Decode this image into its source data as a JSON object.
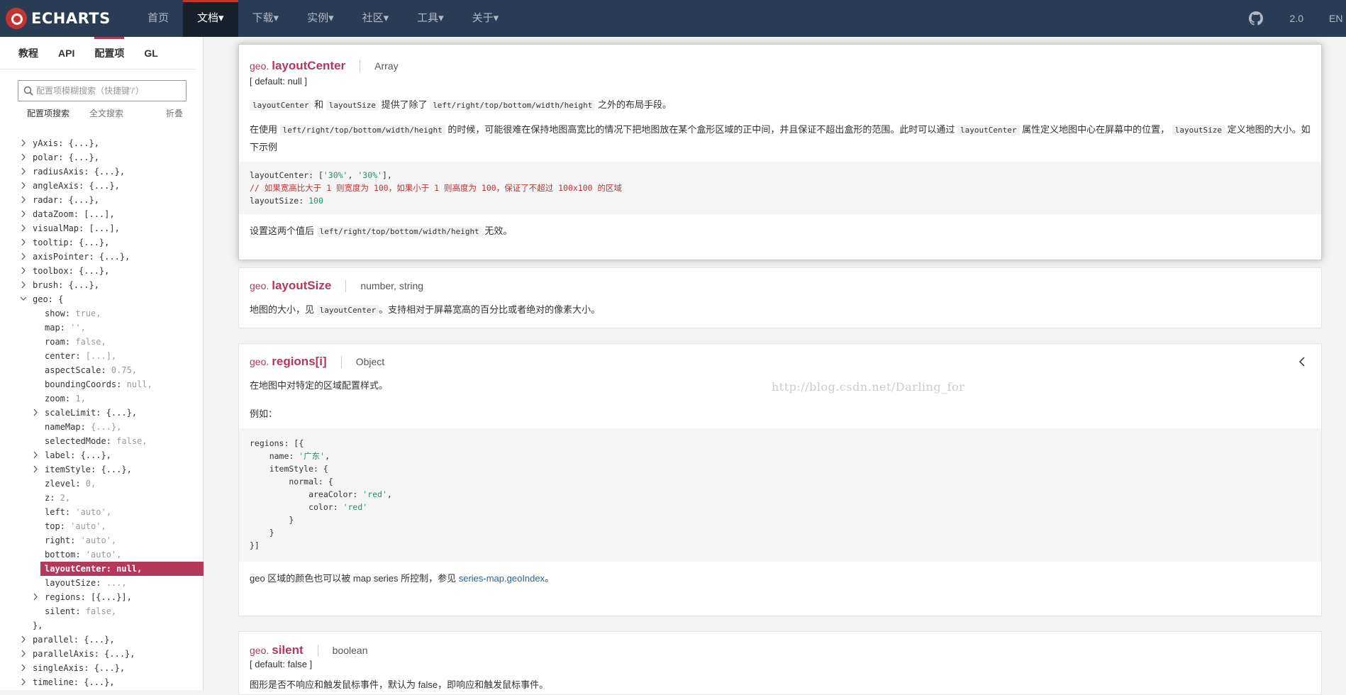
{
  "navbar": {
    "brand": "ECHARTS",
    "items": [
      {
        "label": "首页"
      },
      {
        "label": "文档▾"
      },
      {
        "label": "下载▾"
      },
      {
        "label": "实例▾"
      },
      {
        "label": "社区▾"
      },
      {
        "label": "工具▾"
      },
      {
        "label": "关于▾"
      }
    ],
    "version": "2.0",
    "lang": "EN"
  },
  "sidebar": {
    "tabs": [
      "教程",
      "API",
      "配置项",
      "GL"
    ],
    "search_placeholder": "配置项模糊搜索（快捷键'/'）",
    "search_opt1": "配置项搜索",
    "search_opt2": "全文搜索",
    "collapse": "折叠",
    "tree": [
      {
        "key": "yAxis: {...},",
        "val": "",
        "arrow": "right",
        "indent": 0
      },
      {
        "key": "polar: {...},",
        "val": "",
        "arrow": "right",
        "indent": 0
      },
      {
        "key": "radiusAxis: {...},",
        "val": "",
        "arrow": "right",
        "indent": 0
      },
      {
        "key": "angleAxis: {...},",
        "val": "",
        "arrow": "right",
        "indent": 0
      },
      {
        "key": "radar: {...},",
        "val": "",
        "arrow": "right",
        "indent": 0
      },
      {
        "key": "dataZoom: [...],",
        "val": "",
        "arrow": "right",
        "indent": 0
      },
      {
        "key": "visualMap: [...],",
        "val": "",
        "arrow": "right",
        "indent": 0
      },
      {
        "key": "tooltip: {...},",
        "val": "",
        "arrow": "right",
        "indent": 0
      },
      {
        "key": "axisPointer: {...},",
        "val": "",
        "arrow": "right",
        "indent": 0
      },
      {
        "key": "toolbox: {...},",
        "val": "",
        "arrow": "right",
        "indent": 0
      },
      {
        "key": "brush: {...},",
        "val": "",
        "arrow": "right",
        "indent": 0
      },
      {
        "key": "geo: {",
        "val": "",
        "arrow": "down",
        "indent": 0
      },
      {
        "key": "show: ",
        "val": "true,",
        "arrow": "",
        "indent": 1
      },
      {
        "key": "map: ",
        "val": "'',",
        "arrow": "",
        "indent": 1
      },
      {
        "key": "roam: ",
        "val": "false,",
        "arrow": "",
        "indent": 1
      },
      {
        "key": "center: ",
        "val": "[...],",
        "arrow": "",
        "indent": 1
      },
      {
        "key": "aspectScale: ",
        "val": "0.75,",
        "arrow": "",
        "indent": 1
      },
      {
        "key": "boundingCoords: ",
        "val": "null,",
        "arrow": "",
        "indent": 1
      },
      {
        "key": "zoom: ",
        "val": "1,",
        "arrow": "",
        "indent": 1
      },
      {
        "key": "scaleLimit: {...},",
        "val": "",
        "arrow": "right",
        "indent": 1
      },
      {
        "key": "nameMap: ",
        "val": "{...},",
        "arrow": "",
        "indent": 1
      },
      {
        "key": "selectedMode: ",
        "val": "false,",
        "arrow": "",
        "indent": 1
      },
      {
        "key": "label: {...},",
        "val": "",
        "arrow": "right",
        "indent": 1
      },
      {
        "key": "itemStyle: {...},",
        "val": "",
        "arrow": "right",
        "indent": 1
      },
      {
        "key": "zlevel: ",
        "val": "0,",
        "arrow": "",
        "indent": 1
      },
      {
        "key": "z: ",
        "val": "2,",
        "arrow": "",
        "indent": 1
      },
      {
        "key": "left: ",
        "val": "'auto',",
        "arrow": "",
        "indent": 1
      },
      {
        "key": "top: ",
        "val": "'auto',",
        "arrow": "",
        "indent": 1
      },
      {
        "key": "right: ",
        "val": "'auto',",
        "arrow": "",
        "indent": 1
      },
      {
        "key": "bottom: ",
        "val": "'auto',",
        "arrow": "",
        "indent": 1
      },
      {
        "key": "layoutCenter: ",
        "val": "null,",
        "arrow": "",
        "indent": 1,
        "selected": true
      },
      {
        "key": "layoutSize: ",
        "val": "...,",
        "arrow": "",
        "indent": 1
      },
      {
        "key": "regions: [{...}],",
        "val": "",
        "arrow": "right",
        "indent": 1
      },
      {
        "key": "silent: ",
        "val": "false,",
        "arrow": "",
        "indent": 1
      },
      {
        "key": "},",
        "val": "",
        "arrow": "",
        "indent": 0.5
      },
      {
        "key": "parallel: {...},",
        "val": "",
        "arrow": "right",
        "indent": 0
      },
      {
        "key": "parallelAxis: {...},",
        "val": "",
        "arrow": "right",
        "indent": 0
      },
      {
        "key": "singleAxis: {...},",
        "val": "",
        "arrow": "right",
        "indent": 0
      },
      {
        "key": "timeline: {...},",
        "val": "",
        "arrow": "right",
        "indent": 0
      }
    ]
  },
  "cards": {
    "layoutCenter": {
      "prefix": "geo.",
      "name": "layoutCenter",
      "type": "Array",
      "default": "[ default: null ]",
      "p1_code1": "layoutCenter",
      "p1_and": " 和 ",
      "p1_code2": "layoutSize",
      "p1_mid": " 提供了除了 ",
      "p1_code3": "left/right/top/bottom/width/height",
      "p1_end": " 之外的布局手段。",
      "p2_start": "在使用 ",
      "p2_code1": "left/right/top/bottom/width/height",
      "p2_mid": " 的时候，可能很难在保持地图高宽比的情况下把地图放在某个盒形区域的正中间，并且保证不超出盒形的范围。此时可以通过 ",
      "p2_code2": "layoutCenter",
      "p2_mid2": " 属性定义地图中心在屏幕中的位置， ",
      "p2_code3": "layoutSize",
      "p2_end": " 定义地图的大小。如下示例",
      "code_l1a": "layoutCenter: [",
      "code_l1b": "'30%'",
      "code_l1c": ", ",
      "code_l1d": "'30%'",
      "code_l1e": "],",
      "code_l2": "// 如果宽高比大于 1 则宽度为 100，如果小于 1 则高度为 100，保证了不超过 100x100 的区域",
      "code_l3a": "layoutSize: ",
      "code_l3b": "100",
      "p3_start": "设置这两个值后 ",
      "p3_code": "left/right/top/bottom/width/height",
      "p3_end": " 无效。"
    },
    "layoutSize": {
      "prefix": "geo.",
      "name": "layoutSize",
      "type": "number, string",
      "p_start": "地图的大小，见 ",
      "p_code": "layoutCenter",
      "p_end": "。支持相对于屏幕宽高的百分比或者绝对的像素大小。"
    },
    "regions": {
      "prefix": "geo.",
      "name": "regions[i]",
      "type": "Object",
      "p1": "在地图中对特定的区域配置样式。",
      "p2": "例如：",
      "c1": "regions: [{",
      "c2a": "    name: ",
      "c2b": "'广东'",
      "c2c": ",",
      "c3": "    itemStyle: {",
      "c4": "        normal: {",
      "c5a": "            areaColor: ",
      "c5b": "'red'",
      "c5c": ",",
      "c6a": "            color: ",
      "c6b": "'red'",
      "c7": "        }",
      "c8": "    }",
      "c9": "}]",
      "p3_start": "geo 区域的颜色也可以被 map series 所控制，参见 ",
      "p3_link": "series-map.geoIndex",
      "p3_end": "。"
    },
    "silent": {
      "prefix": "geo.",
      "name": "silent",
      "type": "boolean",
      "default": "[ default: false ]",
      "p": "图形是否不响应和触发鼠标事件，默认为 false，即响应和触发鼠标事件。"
    }
  },
  "watermark": "http://blog.csdn.net/Darling_for"
}
